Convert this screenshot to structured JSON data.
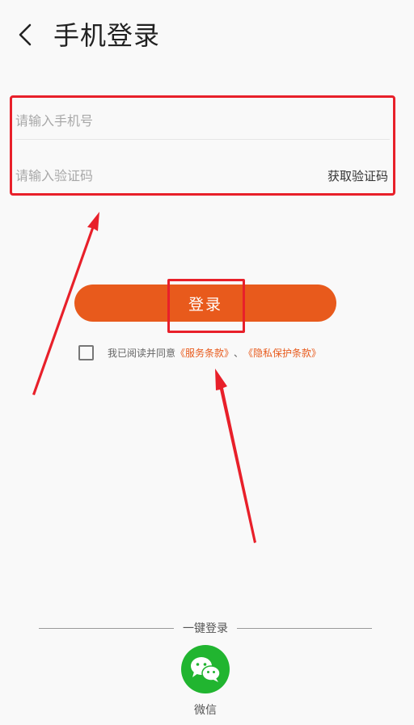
{
  "header": {
    "title": "手机登录",
    "back_icon": "chevron-left-icon"
  },
  "form": {
    "phone_placeholder": "请输入手机号",
    "code_placeholder": "请输入验证码",
    "get_code_label": "获取验证码"
  },
  "login": {
    "button_label": "登录"
  },
  "agreement": {
    "prefix": "我已阅读并同意",
    "terms_link": "《服务条款》",
    "separator": "、",
    "privacy_link": "《隐私保护条款》"
  },
  "oneclick": {
    "label": "一键登录",
    "wechat_label": "微信",
    "wechat_icon": "wechat-icon"
  },
  "colors": {
    "accent": "#e85a1c",
    "annotation": "#e8202a",
    "wechat": "#21b530"
  }
}
